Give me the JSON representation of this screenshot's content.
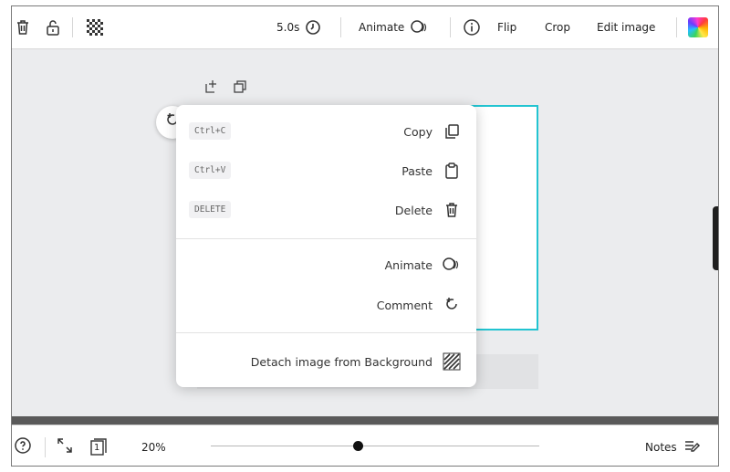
{
  "toolbar": {
    "edit_image_label": "Edit image",
    "crop_label": "Crop",
    "flip_label": "Flip",
    "animate_label": "Animate",
    "duration_label": "5.0s"
  },
  "context_menu": {
    "copy_label": "Copy",
    "copy_shortcut": "Ctrl+C",
    "paste_label": "Paste",
    "paste_shortcut": "Ctrl+V",
    "delete_label": "Delete",
    "delete_shortcut": "DELETE",
    "animate_label": "Animate",
    "comment_label": "Comment",
    "detach_label": "Detach image from Background"
  },
  "bottombar": {
    "notes_label": "Notes",
    "zoom_label": "20%",
    "zoom_level": 0.2,
    "page_count": "1"
  },
  "colors": {
    "selection_border": "#22c4d1",
    "canvas_bg": "#ebecee",
    "hat_blue": "#3b8fd0"
  },
  "icons": [
    "rainbow-logo-icon",
    "info-icon",
    "animate-icon",
    "clock-icon",
    "transparency-icon",
    "unlock-icon",
    "trash-icon",
    "copy-icon",
    "paste-icon",
    "delete-icon",
    "comment-icon",
    "detach-icon",
    "notes-icon",
    "pages-icon",
    "fullscreen-icon",
    "help-icon",
    "duplicate-icon",
    "add-page-icon",
    "rotate-icon"
  ]
}
